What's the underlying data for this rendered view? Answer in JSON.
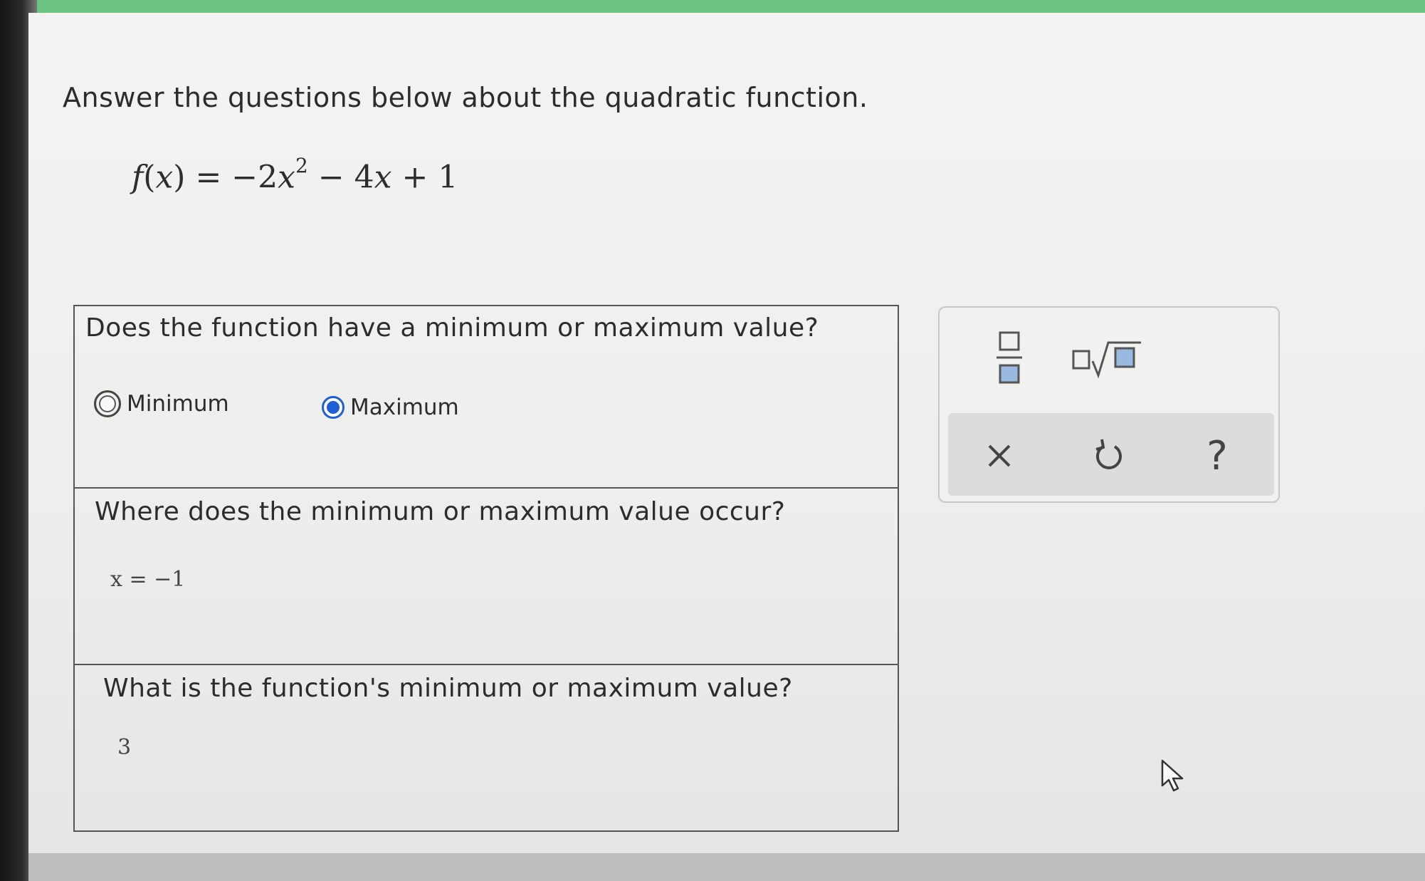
{
  "page": {
    "instructions": "Answer the questions below about the quadratic function."
  },
  "formula": {
    "f": "f",
    "open": "(",
    "x": "x",
    "close_eq": ") = −2",
    "x2": "x",
    "exponent": "2",
    "rest": " − 4",
    "x3": "x",
    "tail": " + 1"
  },
  "questions": {
    "q1": {
      "text": "Does the function have a minimum or maximum value?",
      "options": [
        {
          "label": "Minimum",
          "selected": false
        },
        {
          "label": "Maximum",
          "selected": true
        }
      ]
    },
    "q2": {
      "text": "Where does the minimum or maximum value occur?",
      "answer": "x  =  −1"
    },
    "q3": {
      "text": "What is the function's minimum or maximum value?",
      "answer": "3"
    }
  },
  "toolbox": {
    "help_label": "?",
    "icons": [
      "fraction-icon",
      "square-root-icon",
      "clear-icon",
      "undo-icon",
      "help-icon"
    ]
  },
  "colors": {
    "accent": "#1f5fd6",
    "top_bar": "#6cc27f"
  }
}
